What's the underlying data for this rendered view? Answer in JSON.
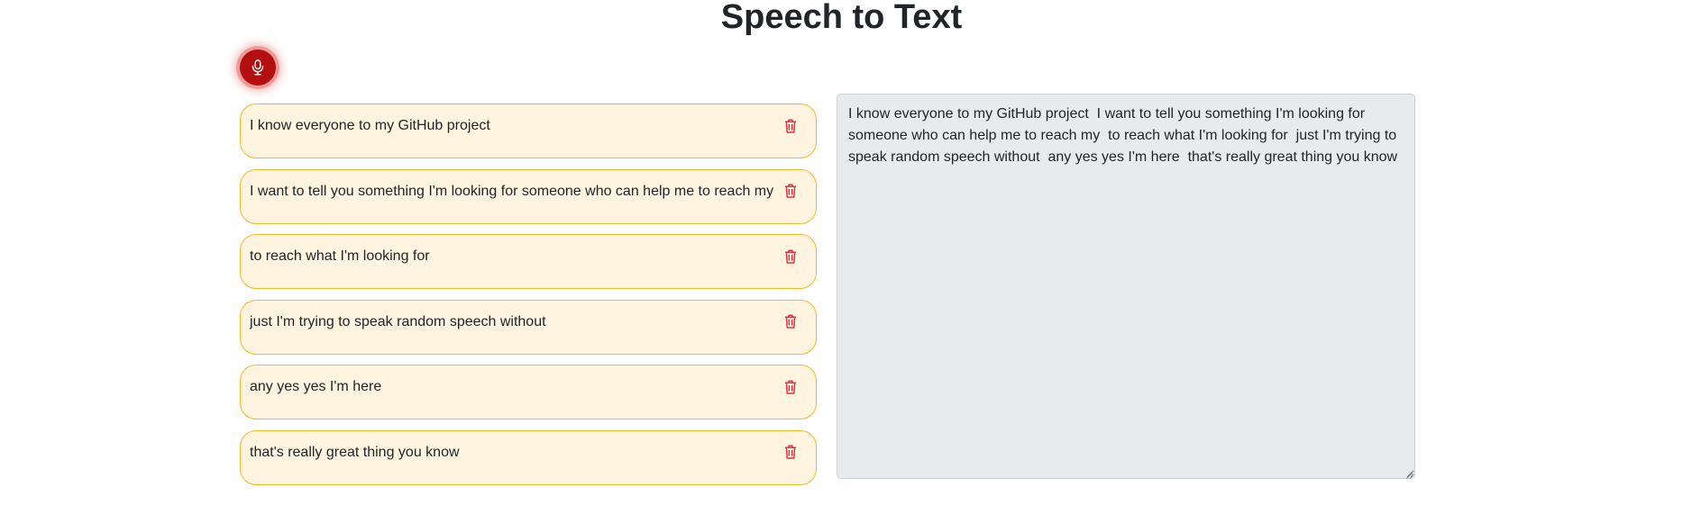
{
  "header": {
    "title": "Speech to Text"
  },
  "mic": {
    "icon": "microphone-icon",
    "color": "#b30f0f"
  },
  "transcripts": [
    {
      "text": "I know everyone to my GitHub project"
    },
    {
      "text": "I want to tell you something I'm looking for someone who can help me to reach my"
    },
    {
      "text": "to reach what I'm looking for"
    },
    {
      "text": "just I'm trying to speak random speech without"
    },
    {
      "text": "any yes yes I'm here"
    },
    {
      "text": "that's really great thing you know"
    }
  ],
  "delete_icon": "trash-icon",
  "output": {
    "value": "I know everyone to my GitHub project  I want to tell you something I'm looking for someone who can help me to reach my  to reach what I'm looking for  just I'm trying to speak random speech without  any yes yes I'm here  that's really great thing you know"
  },
  "colors": {
    "item_background": "#fff4e0",
    "item_border": "#f2b82a",
    "delete_icon": "#dc3545",
    "output_background": "#e8ebee"
  }
}
